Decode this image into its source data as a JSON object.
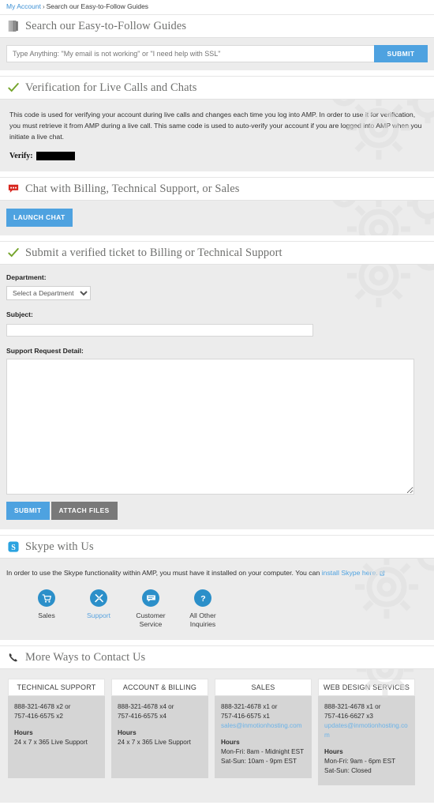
{
  "breadcrumb": {
    "link": "My Account",
    "separator": "›",
    "current": "Search our Easy-to-Follow Guides"
  },
  "colors": {
    "accent_blue": "#4ea2e0",
    "skype_blue": "#2b8fc9",
    "link_blue": "#3b8fd4",
    "grey_button": "#797979",
    "check_green": "#74a42b",
    "chat_red": "#d8271f",
    "section_bg": "#ececec",
    "card_bg": "#d5d5d5"
  },
  "sections": {
    "search": {
      "icon": "book-icon",
      "title": "Search our Easy-to-Follow Guides",
      "input_placeholder": "Type Anything: \"My email is not working\" or \"I need help with SSL\"",
      "input_value": "",
      "submit_label": "SUBMIT"
    },
    "verification": {
      "icon": "check-icon",
      "title": "Verification for Live Calls and Chats",
      "body": "This code is used for verifying your account during live calls and changes each time you log into AMP. In order to use it for verification, you must retrieve it from AMP during a live call. This same code is used to auto-verify your account if you are logged into AMP when you initiate a live chat.",
      "verify_label": "Verify:",
      "verify_value": ""
    },
    "chat": {
      "icon": "speech-bubble-icon",
      "title": "Chat with Billing, Technical Support, or Sales",
      "launch_label": "LAUNCH CHAT"
    },
    "ticket": {
      "icon": "check-icon",
      "title": "Submit a verified ticket to Billing or Technical Support",
      "department_label": "Department:",
      "department_selected": "Select a Department",
      "department_options": [
        "Select a Department"
      ],
      "subject_label": "Subject:",
      "subject_value": "",
      "detail_label": "Support Request Detail:",
      "detail_value": "",
      "submit_label": "SUBMIT",
      "attach_label": "ATTACH FILES"
    },
    "skype": {
      "icon": "skype-icon",
      "title": "Skype with Us",
      "lead_text": "In order to use the Skype functionality within AMP, you must have it installed on your computer. You can ",
      "lead_link": "install Skype here.",
      "external_icon": "external-link-icon",
      "items": [
        {
          "icon": "shopping-cart-icon",
          "label": "Sales",
          "active": false
        },
        {
          "icon": "tools-icon",
          "label": "Support",
          "active": true
        },
        {
          "icon": "chat-icon",
          "label": "Customer\nService",
          "label_line1": "Customer",
          "label_line2": "Service",
          "active": false
        },
        {
          "icon": "question-mark-icon",
          "label": "All Other\nInquiries",
          "label_line1": "All Other",
          "label_line2": "Inquiries",
          "active": false
        }
      ]
    },
    "contact": {
      "icon": "phone-icon",
      "title": "More Ways to Contact Us",
      "cards": [
        {
          "heading": "TECHNICAL SUPPORT",
          "phone_line1": "888-321-4678 x2 or",
          "phone_line2": "757-416-6575 x2",
          "email": "",
          "hours_heading": "Hours",
          "hours_line1": "24 x 7 x 365 Live Support",
          "hours_line2": ""
        },
        {
          "heading": "ACCOUNT & BILLING",
          "phone_line1": "888-321-4678 x4 or",
          "phone_line2": "757-416-6575 x4",
          "email": "",
          "hours_heading": "Hours",
          "hours_line1": "24 x 7 x 365 Live Support",
          "hours_line2": ""
        },
        {
          "heading": "SALES",
          "phone_line1": "888-321-4678 x1 or",
          "phone_line2": "757-416-6575 x1",
          "email": "sales@inmotionhosting.com",
          "hours_heading": "Hours",
          "hours_line1": "Mon-Fri: 8am - Midnight EST",
          "hours_line2": "Sat-Sun: 10am - 9pm EST"
        },
        {
          "heading": "WEB DESIGN SERVICES",
          "phone_line1": "888-321-4678 x1 or",
          "phone_line2": "757-416-6627 x3",
          "email": "updates@inmotionhosting.com",
          "hours_heading": "Hours",
          "hours_line1": "Mon-Fri: 9am - 6pm EST",
          "hours_line2": "Sat-Sun: Closed"
        }
      ]
    }
  }
}
